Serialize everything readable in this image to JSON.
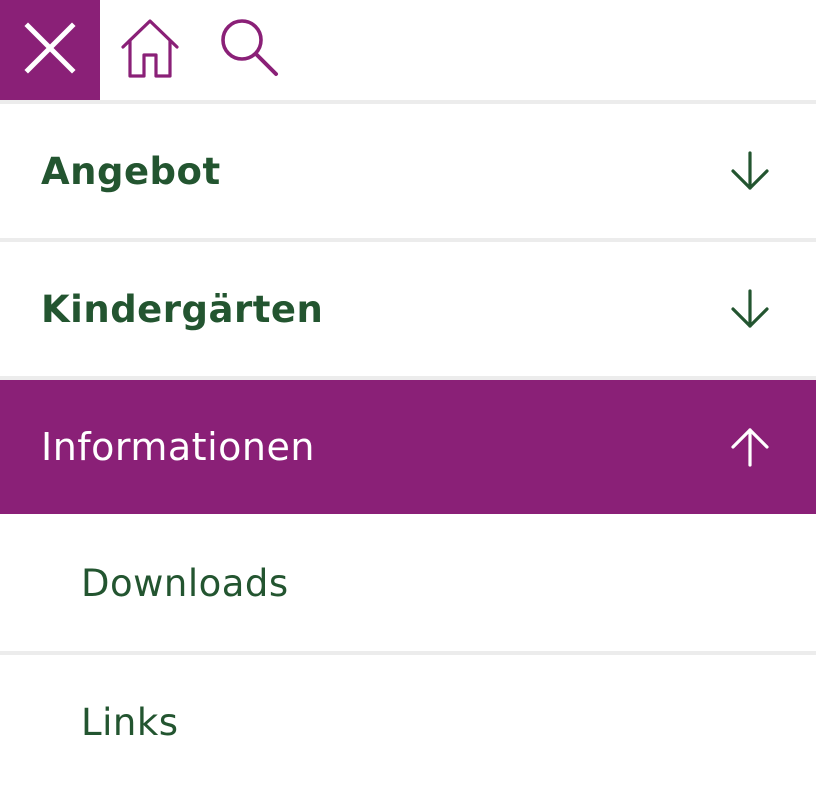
{
  "colors": {
    "accent": "#8a2077",
    "text_green": "#235530",
    "divider": "#ececec",
    "white": "#ffffff"
  },
  "toolbar": {
    "close_icon": "close-icon",
    "home_icon": "home-icon",
    "search_icon": "search-icon"
  },
  "menu": {
    "items": [
      {
        "label": "Angebot",
        "icon": "arrow-down-icon",
        "expanded": false
      },
      {
        "label": "Kindergärten",
        "icon": "arrow-down-icon",
        "expanded": false
      },
      {
        "label": "Informationen",
        "icon": "arrow-up-icon",
        "expanded": true,
        "subitems": [
          {
            "label": "Downloads"
          },
          {
            "label": "Links"
          }
        ]
      }
    ]
  }
}
